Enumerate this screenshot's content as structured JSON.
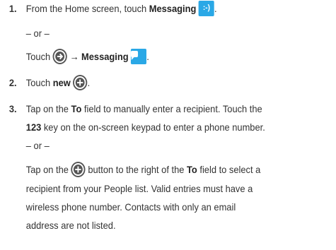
{
  "steps": [
    {
      "number": "1.",
      "line1": {
        "before": "From the Home screen, touch ",
        "bold": "Messaging",
        "icon": "messaging-smiley-icon"
      },
      "or": "– or –",
      "line2": {
        "before": "Touch ",
        "arrow": "→ ",
        "bold": "Messaging",
        "icons": [
          "arrow-circle-icon",
          "messaging-bubble-icon"
        ]
      },
      "glyph": ":-)"
    },
    {
      "number": "2.",
      "line1": {
        "before": "Touch ",
        "bold": "new",
        "icon": "plus-circle-icon"
      }
    },
    {
      "number": "3.",
      "para1": {
        "l1_before": "Tap on the ",
        "l1_bold": "To",
        "l1_after": " field to manually enter a recipient. Touch the",
        "l2_bold": "123",
        "l2_after": " key on the on-screen keypad to enter a phone number."
      },
      "or": "– or –",
      "para2": {
        "l1_before": "Tap on the ",
        "l1_mid": " button to the right of the ",
        "l1_bold": "To",
        "l1_after": " field to select a",
        "l2": "recipient from your People list. Valid entries must have a",
        "l3": "wireless phone number. Contacts with only an email",
        "l4": "address are not listed."
      }
    }
  ],
  "colors": {
    "tile_blue": "#2aa8e6",
    "icon_dark": "#555555",
    "text": "#333333"
  }
}
